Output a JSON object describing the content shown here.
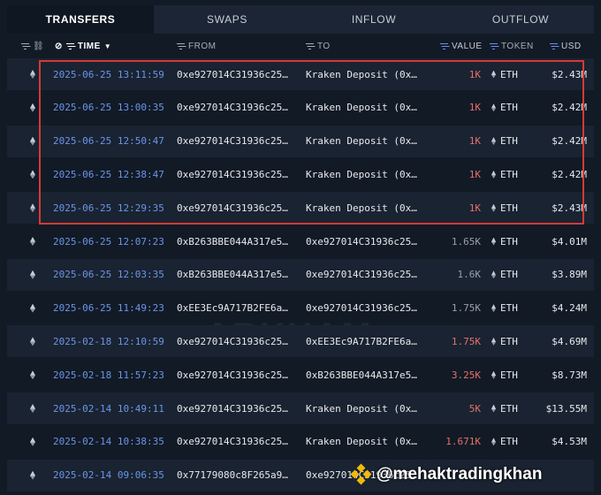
{
  "tabs": [
    {
      "label": "TRANSFERS",
      "active": true
    },
    {
      "label": "SWAPS",
      "active": false
    },
    {
      "label": "INFLOW",
      "active": false
    },
    {
      "label": "OUTFLOW",
      "active": false
    }
  ],
  "columns": {
    "time": "TIME",
    "from": "FROM",
    "to": "TO",
    "value": "VALUE",
    "token": "TOKEN",
    "usd": "USD"
  },
  "rows": [
    {
      "time": "2025-06-25 13:11:59",
      "from": "0xe927014C31936c25…",
      "to": "Kraken Deposit (0x…",
      "value": "1K",
      "value_color": "red",
      "token": "ETH",
      "usd": "$2.43M"
    },
    {
      "time": "2025-06-25 13:00:35",
      "from": "0xe927014C31936c25…",
      "to": "Kraken Deposit (0x…",
      "value": "1K",
      "value_color": "red",
      "token": "ETH",
      "usd": "$2.42M"
    },
    {
      "time": "2025-06-25 12:50:47",
      "from": "0xe927014C31936c25…",
      "to": "Kraken Deposit (0x…",
      "value": "1K",
      "value_color": "red",
      "token": "ETH",
      "usd": "$2.42M"
    },
    {
      "time": "2025-06-25 12:38:47",
      "from": "0xe927014C31936c25…",
      "to": "Kraken Deposit (0x…",
      "value": "1K",
      "value_color": "red",
      "token": "ETH",
      "usd": "$2.42M"
    },
    {
      "time": "2025-06-25 12:29:35",
      "from": "0xe927014C31936c25…",
      "to": "Kraken Deposit (0x…",
      "value": "1K",
      "value_color": "red",
      "token": "ETH",
      "usd": "$2.43M"
    },
    {
      "time": "2025-06-25 12:07:23",
      "from": "0xB263BBE044A317e5…",
      "to": "0xe927014C31936c25…",
      "value": "1.65K",
      "value_color": "grey",
      "token": "ETH",
      "usd": "$4.01M"
    },
    {
      "time": "2025-06-25 12:03:35",
      "from": "0xB263BBE044A317e5…",
      "to": "0xe927014C31936c25…",
      "value": "1.6K",
      "value_color": "grey",
      "token": "ETH",
      "usd": "$3.89M"
    },
    {
      "time": "2025-06-25 11:49:23",
      "from": "0xEE3Ec9A717B2FE6a…",
      "to": "0xe927014C31936c25…",
      "value": "1.75K",
      "value_color": "grey",
      "token": "ETH",
      "usd": "$4.24M"
    },
    {
      "time": "2025-02-18 12:10:59",
      "from": "0xe927014C31936c25…",
      "to": "0xEE3Ec9A717B2FE6a…",
      "value": "1.75K",
      "value_color": "red",
      "token": "ETH",
      "usd": "$4.69M"
    },
    {
      "time": "2025-02-18 11:57:23",
      "from": "0xe927014C31936c25…",
      "to": "0xB263BBE044A317e5…",
      "value": "3.25K",
      "value_color": "red",
      "token": "ETH",
      "usd": "$8.73M"
    },
    {
      "time": "2025-02-14 10:49:11",
      "from": "0xe927014C31936c25…",
      "to": "Kraken Deposit (0x…",
      "value": "5K",
      "value_color": "red",
      "token": "ETH",
      "usd": "$13.55M"
    },
    {
      "time": "2025-02-14 10:38:35",
      "from": "0xe927014C31936c25…",
      "to": "Kraken Deposit (0x…",
      "value": "1.671K",
      "value_color": "red",
      "token": "ETH",
      "usd": "$4.53M"
    },
    {
      "time": "2025-02-14 09:06:35",
      "from": "0x77179080c8F265a9…",
      "to": "0xe927014C31936c25…",
      "value": "",
      "value_color": "grey",
      "token": "",
      "usd": ""
    }
  ],
  "watermark": "ARKHAM",
  "credit": "@mehaktradingkhan",
  "colors": {
    "background": "#121a26",
    "accent_blue": "#6b95e8",
    "outflow_red": "#e4716a",
    "highlight_border": "#d43a35"
  }
}
